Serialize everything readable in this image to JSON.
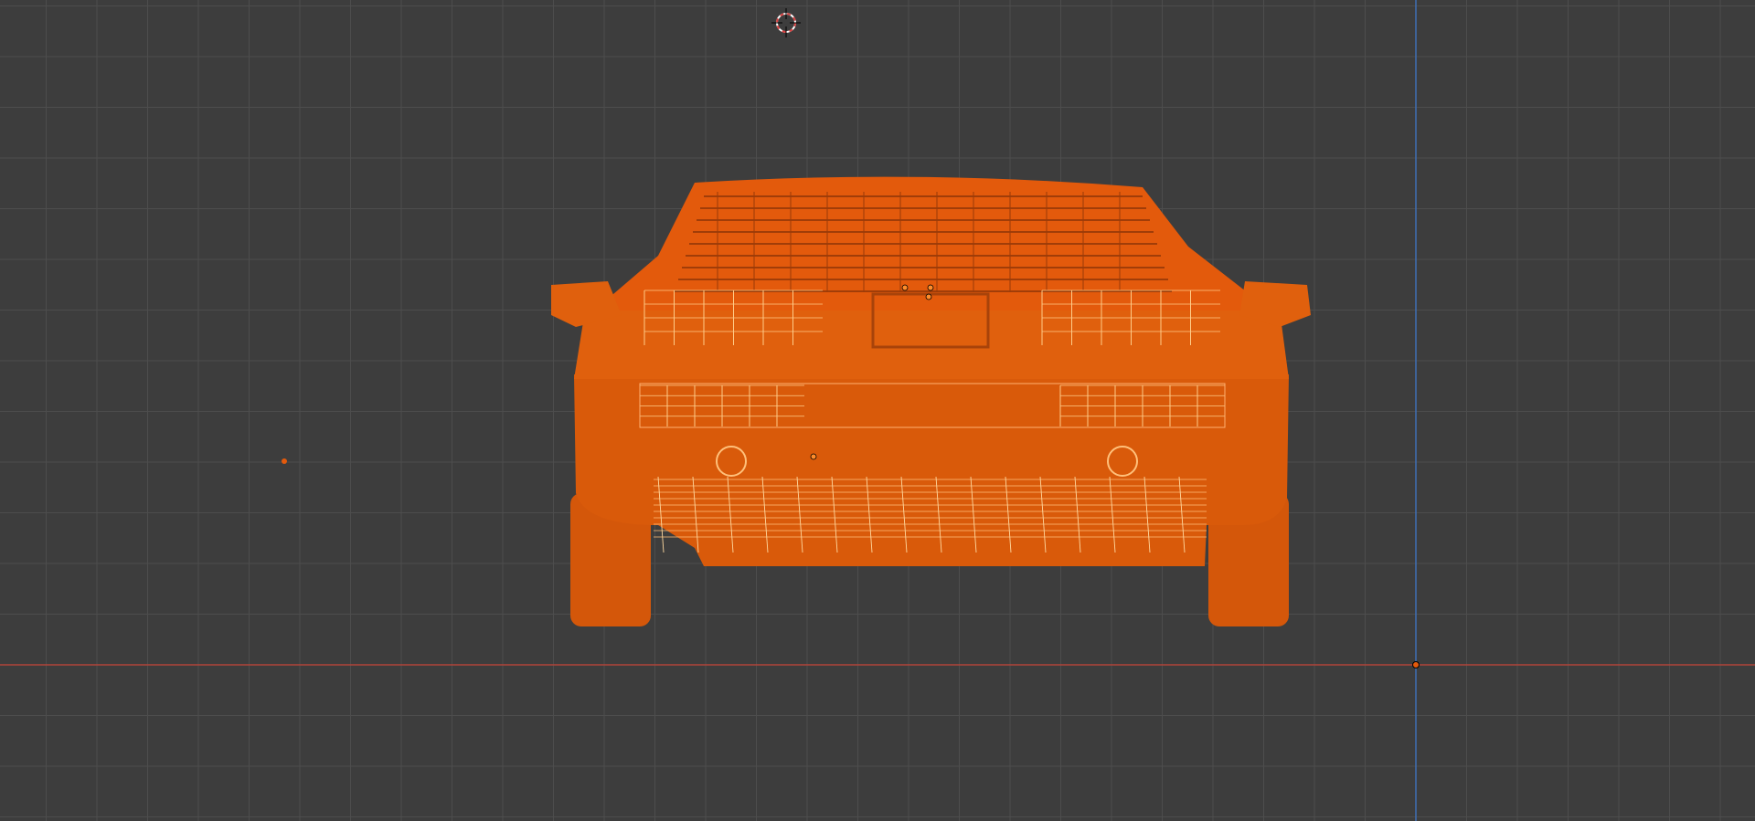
{
  "viewport": {
    "background_color": "#3d3d3d",
    "grid_color": "#4d4d4d",
    "x_axis_color": "#b0453a",
    "z_axis_color": "#3f6fb5",
    "selection_color": "#e35a0c",
    "selection_highlight_color": "#ff9a3c",
    "wire_color": "#ffc07a"
  },
  "scene": {
    "selected_object": "car-model",
    "view": "front-orthographic",
    "shading": "wireframe"
  },
  "icons": {
    "cursor": "3d-cursor-icon",
    "origin": "object-origin-icon"
  }
}
